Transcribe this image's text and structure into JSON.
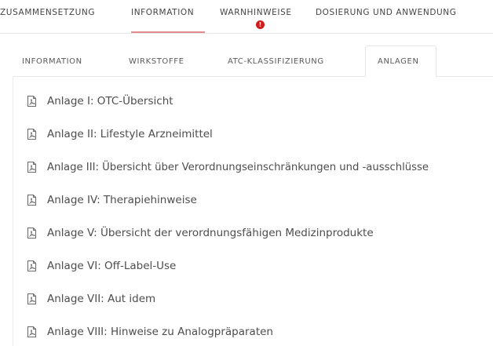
{
  "top_tabs": [
    {
      "label": "ZUSAMMENSETZUNG"
    },
    {
      "label": "INFORMATION"
    },
    {
      "label": "WARNHINWEISE"
    },
    {
      "label": "DOSIERUNG UND ANWENDUNG"
    }
  ],
  "active_top_tab": "INFORMATION",
  "warning_badge": "!",
  "sub_tabs": [
    {
      "label": "INFORMATION"
    },
    {
      "label": "WIRKSTOFFE"
    },
    {
      "label": "ATC-KLASSIFIZIERUNG"
    },
    {
      "label": "ANLAGEN"
    }
  ],
  "active_sub_tab": "ANLAGEN",
  "anlagen": [
    {
      "label": "Anlage I: OTC-Übersicht",
      "icon": "pdf-icon"
    },
    {
      "label": "Anlage II: Lifestyle Arzneimittel",
      "icon": "pdf-icon"
    },
    {
      "label": "Anlage III: Übersicht über Verordnungseinschränkungen und -ausschlüsse",
      "icon": "pdf-icon"
    },
    {
      "label": "Anlage IV: Therapiehinweise",
      "icon": "pdf-icon"
    },
    {
      "label": "Anlage V: Übersicht der verordnungsfähigen Medizinprodukte",
      "icon": "pdf-icon"
    },
    {
      "label": "Anlage VI: Off-Label-Use",
      "icon": "pdf-icon"
    },
    {
      "label": "Anlage VII: Aut idem",
      "icon": "pdf-icon"
    },
    {
      "label": "Anlage VIII: Hinweise zu Analogpräparaten",
      "icon": "pdf-icon"
    }
  ],
  "colors": {
    "accent_underline": "#e38c8c",
    "warning": "#d11a1a"
  }
}
